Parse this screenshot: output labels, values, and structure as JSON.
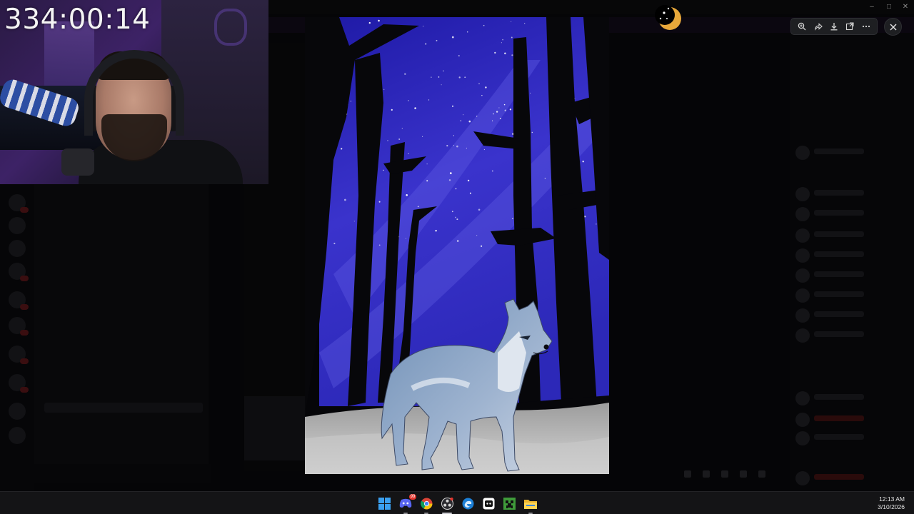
{
  "stream_overlay": {
    "timer": "334:00:14"
  },
  "image_viewer": {
    "toolbar": {
      "zoom_icon": "zoom-in-icon",
      "forward_icon": "share-forward-icon",
      "download_icon": "download-icon",
      "open_external_icon": "open-external-icon",
      "more_icon": "more-options-icon"
    },
    "close_icon": "close-icon",
    "image_subject": "wolf standing in night forest painting"
  },
  "taskbar": {
    "apps": [
      {
        "name": "start",
        "icon": "windows-start-icon"
      },
      {
        "name": "discord",
        "icon": "discord-icon",
        "badge": "99"
      },
      {
        "name": "chrome",
        "icon": "chrome-icon"
      },
      {
        "name": "obs",
        "icon": "obs-icon"
      },
      {
        "name": "edge",
        "icon": "edge-icon"
      },
      {
        "name": "app",
        "icon": "app-icon"
      },
      {
        "name": "minecraft",
        "icon": "minecraft-icon"
      },
      {
        "name": "file-explorer",
        "icon": "folder-icon"
      }
    ],
    "clock": {
      "time": "12:13 AM",
      "date": "3/10/2026"
    }
  },
  "colors": {
    "sky_top": "#2a22b8",
    "sky_bottom": "#4a44d8",
    "tree": "#07070a",
    "ground": "#b8b8b8",
    "taskbar": "#141416",
    "timer_text": "#f4f4f4"
  }
}
